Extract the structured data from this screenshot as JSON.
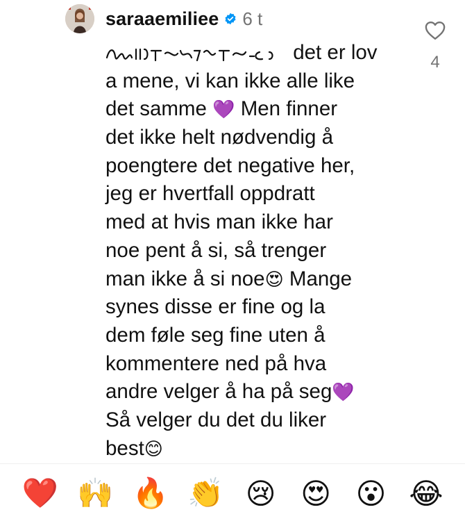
{
  "comment": {
    "username": "saraaemiliee",
    "timestamp": "6 t",
    "like_count": "4",
    "lines": [
      {
        "pre": "",
        "text": "det er lov"
      },
      {
        "text": "a mene, vi kan ikke alle like"
      },
      {
        "text": "det samme ",
        "emoji": "💜",
        "tail": " Men finner"
      },
      {
        "text": "det ikke helt nødvendig å"
      },
      {
        "text": "poengtere det negative her,"
      },
      {
        "text": "jeg er hvertfall oppdratt"
      },
      {
        "text": "med at hvis man ikke har"
      },
      {
        "text": "noe pent å si, så trenger"
      },
      {
        "text": "man ikke å si noe",
        "emoji": "😍",
        "tail": " Mange"
      },
      {
        "text": "synes disse er fine og la"
      },
      {
        "text": "dem føle seg fine uten å"
      },
      {
        "text": "kommentere ned på hva"
      },
      {
        "text": "andre velger å ha på seg",
        "emoji": "💜",
        "tail": ""
      },
      {
        "text": "Så velger du det du liker"
      },
      {
        "text": "best",
        "emoji": "😊",
        "tail": ""
      }
    ]
  },
  "icons": {
    "like": "heart-outline-icon",
    "verified": "verified-badge-icon",
    "accent": "#0095f6"
  },
  "reactions": [
    "❤️",
    "🙌",
    "🔥",
    "👏",
    "😢",
    "😍",
    "😮",
    "😂"
  ]
}
